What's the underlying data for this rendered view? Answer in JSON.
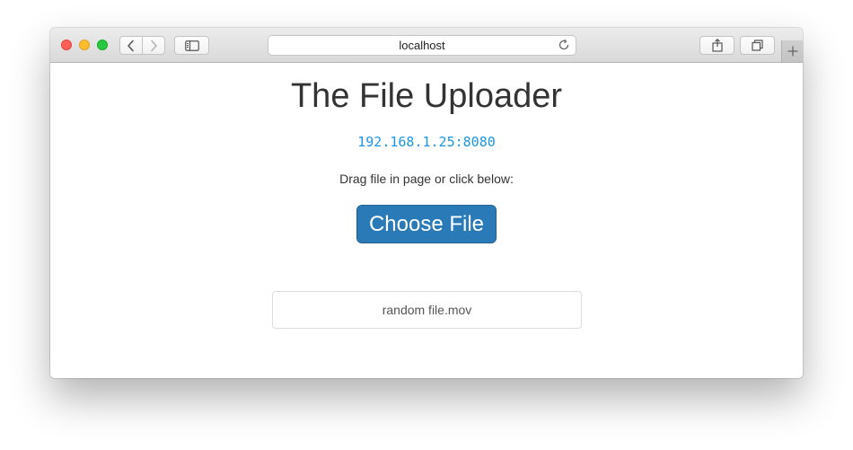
{
  "browser": {
    "url": "localhost",
    "icons": {
      "back": "chevron-left-icon",
      "forward": "chevron-right-icon",
      "sidebar": "sidebar-icon",
      "reload": "reload-icon",
      "share": "share-icon",
      "tabs": "tabs-overview-icon",
      "new_tab": "plus-icon"
    }
  },
  "page": {
    "title": "The File Uploader",
    "address": "192.168.1.25:8080",
    "instruction": "Drag file in page or click below:",
    "choose_button": "Choose File",
    "files": [
      {
        "name": "random file.mov"
      }
    ]
  },
  "colors": {
    "accent_button": "#2a7ab8",
    "address_text": "#1a96e5",
    "title_text": "#333333"
  }
}
